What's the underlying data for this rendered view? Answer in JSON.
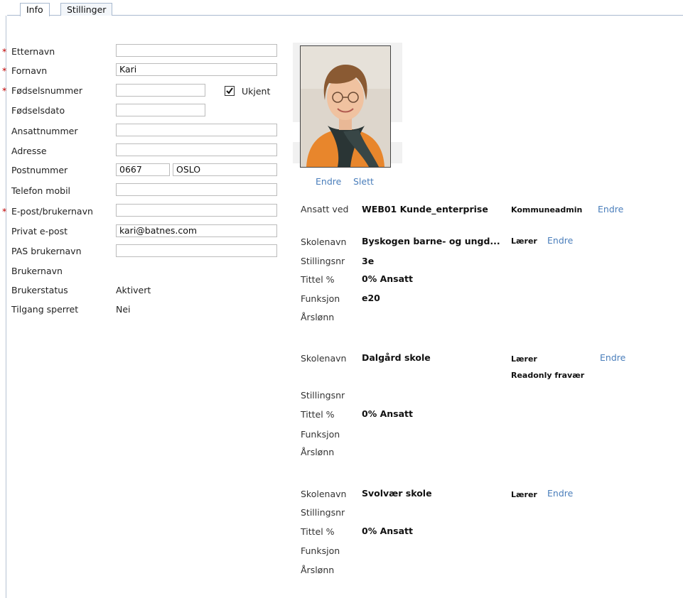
{
  "tabs": [
    {
      "label": "Info",
      "active": true
    },
    {
      "label": "Stillinger",
      "active": false
    }
  ],
  "form": {
    "etternavn": {
      "label": "Etternavn",
      "required": true,
      "value": ""
    },
    "fornavn": {
      "label": "Fornavn",
      "required": true,
      "value": "Kari"
    },
    "fodselsnummer": {
      "label": "Fødselsnummer",
      "required": true,
      "value": ""
    },
    "ukjent_label": "Ukjent",
    "ukjent_checked": true,
    "fodselsdato": {
      "label": "Fødselsdato",
      "value": ""
    },
    "ansattnummer": {
      "label": "Ansattnummer",
      "value": ""
    },
    "adresse": {
      "label": "Adresse",
      "value": ""
    },
    "postnummer": {
      "label": "Postnummer",
      "value": "0667",
      "city": "OSLO"
    },
    "telefon": {
      "label": "Telefon mobil",
      "value": ""
    },
    "epost_bruker": {
      "label": "E-post/brukernavn",
      "required": true,
      "value": ""
    },
    "privat_epost": {
      "label": "Privat e-post",
      "value": "kari@batnes.com"
    },
    "pas": {
      "label": "PAS brukernavn",
      "value": ""
    },
    "brukernavn": {
      "label": "Brukernavn",
      "value": ""
    },
    "brukerstatus": {
      "label": "Brukerstatus",
      "value": "Aktivert"
    },
    "tilgang": {
      "label": "Tilgang sperret",
      "value": "Nei"
    }
  },
  "photo": {
    "edit_label": "Endre",
    "delete_label": "Slett"
  },
  "ansatt": {
    "label": "Ansatt ved",
    "value": "WEB01 Kunde_enterprise",
    "role": "Kommuneadmin",
    "edit_label": "Endre"
  },
  "labels": {
    "skolenavn": "Skolenavn",
    "stillingsnr": "Stillingsnr",
    "tittel": "Tittel %",
    "funksjon": "Funksjon",
    "arslonn": "Årslønn"
  },
  "positions": [
    {
      "skolenavn": "Byskogen barne- og ungd...",
      "role": "Lærer",
      "role2": "",
      "edit_label": "Endre",
      "stillingsnr": "3e",
      "tittel": "0% Ansatt",
      "funksjon": "e20",
      "arslonn": ""
    },
    {
      "skolenavn": "Dalgård skole",
      "role": "Lærer",
      "role2": "Readonly fravær",
      "edit_label": "Endre",
      "stillingsnr": "",
      "tittel": "0% Ansatt",
      "funksjon": "",
      "arslonn": ""
    },
    {
      "skolenavn": "Svolvær skole",
      "role": "Lærer",
      "role2": "",
      "edit_label": "Endre",
      "stillingsnr": "",
      "tittel": "0% Ansatt",
      "funksjon": "",
      "arslonn": ""
    }
  ]
}
